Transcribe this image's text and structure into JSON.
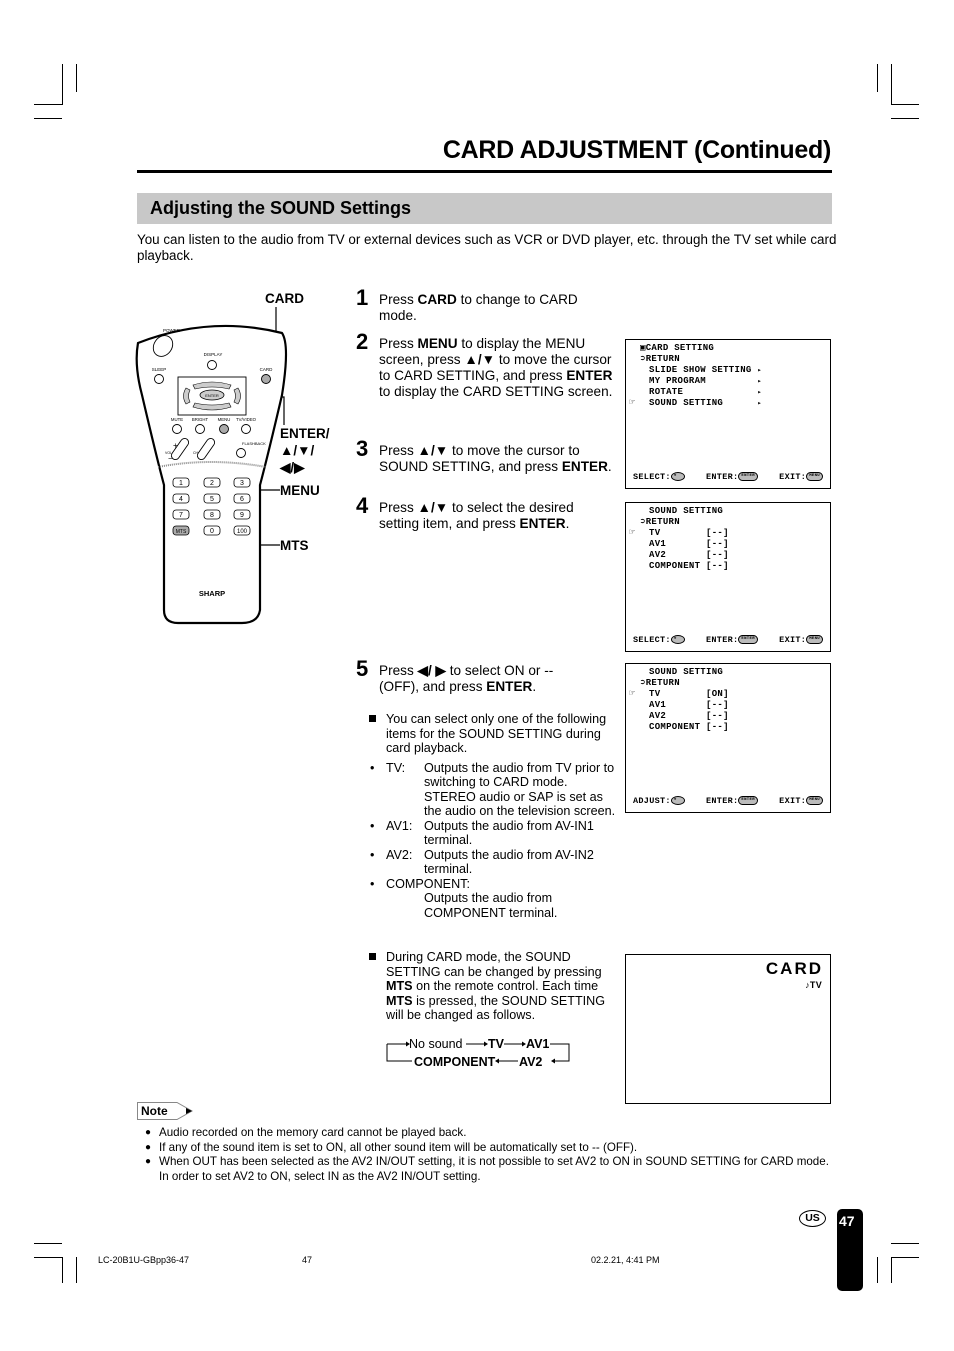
{
  "page": {
    "title": "CARD ADJUSTMENT (Continued)",
    "section_title": "Adjusting the SOUND Settings",
    "intro": "You can listen to the audio from TV or external devices such as VCR or DVD player, etc. through the TV set while card playback."
  },
  "remote": {
    "brand": "SHARP",
    "labels": {
      "power": "POWER",
      "display": "DISPLAY",
      "sleep": "SLEEP",
      "card": "CARD",
      "enter": "ENTER",
      "mute": "MUTE",
      "bright": "BRIGHT",
      "menu": "MENU",
      "tvvideo": "TV/VIDEO",
      "flashback": "FLASHBACK",
      "vol": "VOL",
      "ch": "CH"
    },
    "keys": [
      "1",
      "2",
      "3",
      "4",
      "5",
      "6",
      "7",
      "8",
      "9",
      "MTS",
      "0",
      "100"
    ],
    "callouts": {
      "card": "CARD",
      "enter_1": "ENTER/",
      "enter_2": "▲/▼/",
      "enter_3": "◀/▶",
      "menu": "MENU",
      "mts": "MTS"
    }
  },
  "steps": [
    {
      "num": "1",
      "parts": [
        [
          "Press ",
          false
        ],
        [
          "CARD",
          true
        ],
        [
          " to change to CARD mode.",
          false
        ]
      ]
    },
    {
      "num": "2",
      "parts": [
        [
          "Press ",
          false
        ],
        [
          "MENU",
          true
        ],
        [
          " to display the MENU screen, press ",
          false
        ],
        [
          "▲/▼",
          true
        ],
        [
          " to move the cursor to CARD SETTING, and press ",
          false
        ],
        [
          "ENTER",
          true
        ],
        [
          " to display the CARD SETTING screen.",
          false
        ]
      ]
    },
    {
      "num": "3",
      "parts": [
        [
          "Press ",
          false
        ],
        [
          "▲/▼",
          true
        ],
        [
          " to move the cursor to SOUND SETTING, and press ",
          false
        ],
        [
          "ENTER",
          true
        ],
        [
          ".",
          false
        ]
      ]
    },
    {
      "num": "4",
      "parts": [
        [
          "Press ",
          false
        ],
        [
          "▲/▼",
          true
        ],
        [
          " to select the desired setting item, and press ",
          false
        ],
        [
          "ENTER",
          true
        ],
        [
          ".",
          false
        ]
      ]
    },
    {
      "num": "5",
      "parts": [
        [
          "Press ",
          false
        ],
        [
          "◀/ ▶",
          true
        ],
        [
          " to select ON or -- (OFF), and press ",
          false
        ],
        [
          "ENTER",
          true
        ],
        [
          ".",
          false
        ]
      ]
    }
  ],
  "bullets": {
    "intro": "You can select only one of the following items for the SOUND SETTING during card playback.",
    "items": [
      {
        "term": "TV:",
        "desc": "Outputs the audio from TV prior to switching to CARD mode. STEREO audio or SAP is set as the audio on the television screen."
      },
      {
        "term": "AV1:",
        "desc": "Outputs the audio from AV-IN1 terminal."
      },
      {
        "term": "AV2:",
        "desc": "Outputs the audio from AV-IN2 terminal."
      },
      {
        "term": "COMPONENT:",
        "desc": "Outputs the audio from COMPONENT terminal."
      }
    ],
    "mts_parts": [
      [
        "During CARD mode, the SOUND SETTING can be changed by pressing ",
        false
      ],
      [
        "MTS",
        true
      ],
      [
        " on the remote control.  Each time ",
        false
      ],
      [
        "MTS",
        true
      ],
      [
        " is pressed, the SOUND SETTING will be changed as follows.",
        false
      ]
    ]
  },
  "cycle": {
    "no_sound": "No sound",
    "tv": "TV",
    "av1": "AV1",
    "av2": "AV2",
    "component": "COMPONENT"
  },
  "osd1": {
    "title": "CARD SETTING",
    "return": "RETURN",
    "items": [
      "SLIDE SHOW SETTING",
      "MY PROGRAM",
      "ROTATE",
      "SOUND SETTING"
    ],
    "selected_index": 3,
    "footer": {
      "left": "SELECT:",
      "mid": "ENTER:",
      "right": "EXIT:",
      "enter_btn": "ENTER",
      "menu_btn": "MENU"
    }
  },
  "osd2": {
    "title": "SOUND SETTING",
    "return": "RETURN",
    "items": [
      {
        "name": "TV",
        "value": "[--]"
      },
      {
        "name": "AV1",
        "value": "[--]"
      },
      {
        "name": "AV2",
        "value": "[--]"
      },
      {
        "name": "COMPONENT",
        "value": "[--]"
      }
    ],
    "selected_index": 0,
    "footer": {
      "left": "SELECT:",
      "mid": "ENTER:",
      "right": "EXIT:",
      "enter_btn": "ENTER",
      "menu_btn": "MENU"
    }
  },
  "osd3": {
    "title": "SOUND SETTING",
    "return": "RETURN",
    "items": [
      {
        "name": "TV",
        "value": "[ON]"
      },
      {
        "name": "AV1",
        "value": "[--]"
      },
      {
        "name": "AV2",
        "value": "[--]"
      },
      {
        "name": "COMPONENT",
        "value": "[--]"
      }
    ],
    "selected_index": 0,
    "footer": {
      "left": "ADJUST:",
      "mid": "ENTER:",
      "right": "EXIT:",
      "enter_btn": "ENTER",
      "menu_btn": "MENU"
    }
  },
  "osd4": {
    "mode": "CARD",
    "sound": "♪TV"
  },
  "note": {
    "label": "Note",
    "items": [
      "Audio recorded on the memory card cannot be played back.",
      "If any of the sound item is set to ON, all other sound item will be automatically set to -- (OFF).",
      "When OUT has been selected as the AV2 IN/OUT setting, it is not possible to set AV2 to ON in SOUND SETTING for CARD mode. In order to set AV2 to ON, select IN as the AV2 IN/OUT setting."
    ]
  },
  "footer": {
    "region_badge": "US",
    "page_number": "47",
    "file_name": "LC-20B1U-GBpp36-47",
    "file_page": "47",
    "timestamp": "02.2.21, 4:41 PM"
  }
}
